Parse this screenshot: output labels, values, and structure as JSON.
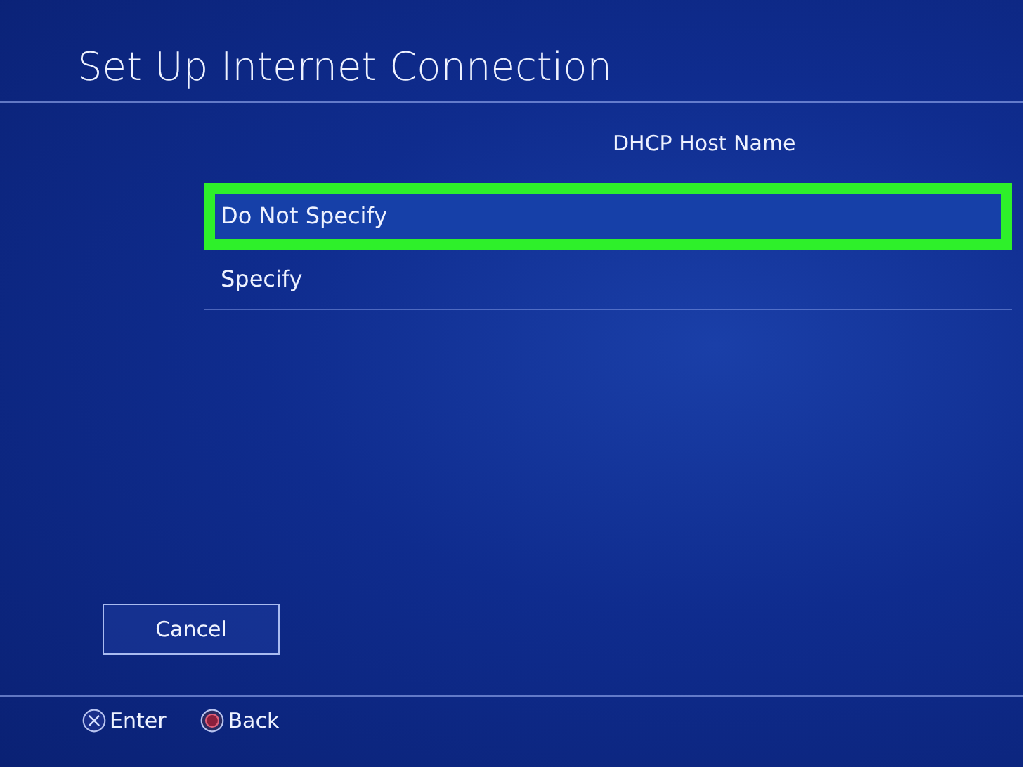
{
  "title": "Set Up Internet Connection",
  "heading": "DHCP Host Name",
  "options": [
    {
      "label": "Do Not Specify",
      "selected": true
    },
    {
      "label": "Specify",
      "selected": false
    }
  ],
  "cancel_button": "Cancel",
  "hints": [
    {
      "kind": "cross",
      "label": "Enter"
    },
    {
      "kind": "circle",
      "label": "Back"
    }
  ]
}
